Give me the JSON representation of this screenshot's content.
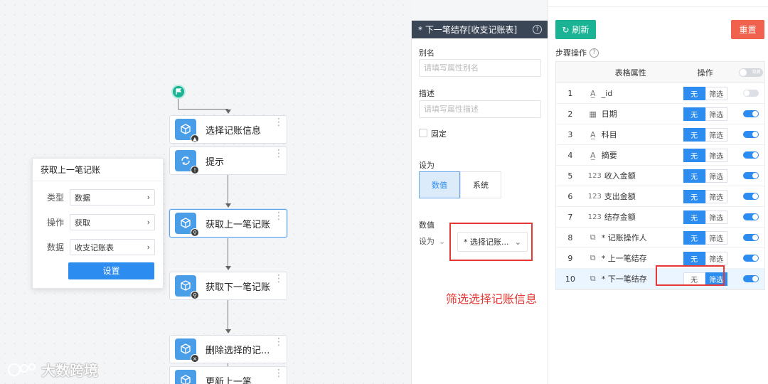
{
  "canvas": {
    "nodes": [
      {
        "label": "选择记账信息",
        "icon": "cube-icon",
        "badge": "cursor"
      },
      {
        "label": "提示",
        "icon": "refresh-icon",
        "badge": "!"
      },
      {
        "label": "获取上一笔记账",
        "icon": "cube-icon",
        "badge": "search"
      },
      {
        "label": "获取下一笔记账",
        "icon": "cube-icon",
        "badge": "search"
      },
      {
        "label": "删除选择的记...",
        "icon": "cube-icon",
        "badge": "×"
      },
      {
        "label": "更新上一笔",
        "icon": "cube-icon",
        "badge": ""
      }
    ],
    "popup": {
      "title": "获取上一笔记账",
      "rows": [
        {
          "label": "类型",
          "value": "数据"
        },
        {
          "label": "操作",
          "value": "获取"
        },
        {
          "label": "数据",
          "value": "收支记账表"
        }
      ],
      "button": "设置"
    },
    "watermark": "大数跨境"
  },
  "middle": {
    "title": "* 下一笔结存[收支记账表]",
    "alias_label": "别名",
    "alias_placeholder": "请填写属性别名",
    "desc_label": "描述",
    "desc_placeholder": "请填写属性描述",
    "fixed_label": "固定",
    "setas_label": "设为",
    "seg": [
      "数值",
      "系统"
    ],
    "value_label": "数值",
    "setas_select": "设为",
    "value_select": "* 选择记账...",
    "annotation": "筛选选择记账信息"
  },
  "right": {
    "refresh": "刷新",
    "reset": "重置",
    "steps_label": "步骤操作",
    "headers": {
      "attr": "表格属性",
      "op": "操作",
      "toggle": "隐藏"
    },
    "op_none": "无",
    "op_filter": "筛选",
    "rows": [
      {
        "idx": "1",
        "type": "A",
        "name": "_id",
        "on": false,
        "filter": false
      },
      {
        "idx": "2",
        "type": "cal",
        "name": "日期",
        "on": true,
        "filter": false
      },
      {
        "idx": "3",
        "type": "A",
        "name": "科目",
        "on": true,
        "filter": false
      },
      {
        "idx": "4",
        "type": "A",
        "name": "摘要",
        "on": true,
        "filter": false
      },
      {
        "idx": "5",
        "type": "123",
        "name": "收入金额",
        "on": true,
        "filter": false
      },
      {
        "idx": "6",
        "type": "123",
        "name": "支出金额",
        "on": true,
        "filter": false
      },
      {
        "idx": "7",
        "type": "123",
        "name": "结存金额",
        "on": true,
        "filter": false
      },
      {
        "idx": "8",
        "type": "link",
        "name": "* 记账操作人",
        "on": true,
        "filter": false
      },
      {
        "idx": "9",
        "type": "link",
        "name": "* 上一笔结存",
        "on": true,
        "filter": false
      },
      {
        "idx": "10",
        "type": "link",
        "name": "* 下一笔结存",
        "on": true,
        "filter": true
      }
    ]
  },
  "colors": {
    "primary": "#2d8cf0",
    "green": "#1ab394",
    "red": "#f0624d",
    "annotation": "#e53935",
    "header": "#3a4556"
  }
}
